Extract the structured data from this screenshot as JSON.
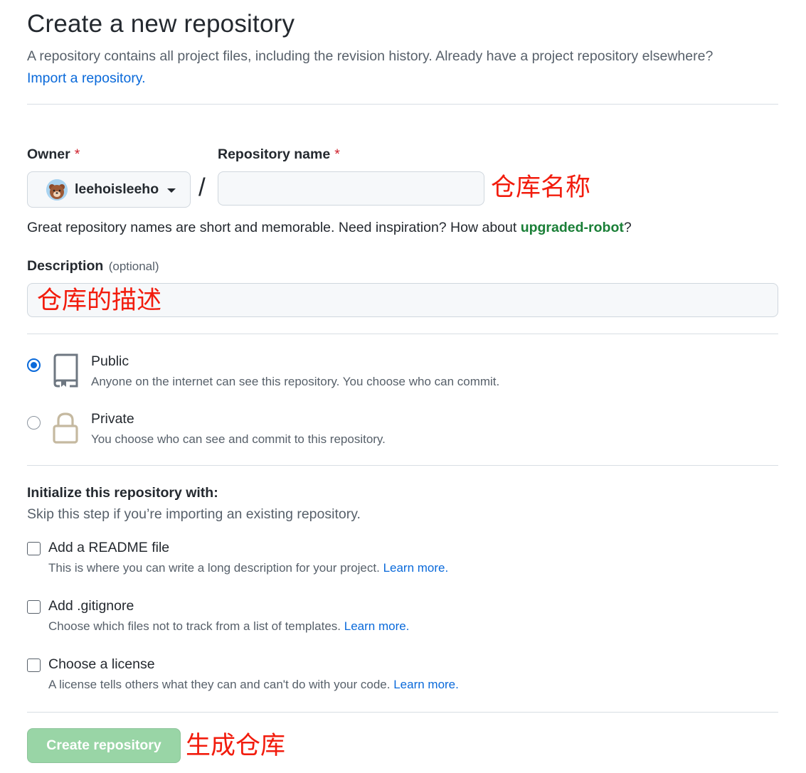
{
  "header": {
    "title": "Create a new repository",
    "subtitle": "A repository contains all project files, including the revision history. Already have a project repository elsewhere?",
    "import_link": "Import a repository."
  },
  "owner": {
    "label": "Owner",
    "required_mark": "*",
    "value": "leehoisleeho",
    "caret_icon": "triangle-down-icon"
  },
  "repo_name": {
    "label": "Repository name",
    "required_mark": "*",
    "value": "",
    "separator": "/",
    "annotation": "仓库名称"
  },
  "name_hint": {
    "prefix": "Great repository names are short and memorable. Need inspiration? How about ",
    "suggestion": "upgraded-robot",
    "suffix": "?"
  },
  "description": {
    "label": "Description",
    "optional": "(optional)",
    "value": "",
    "annotation": "仓库的描述"
  },
  "visibility": {
    "selected": "public",
    "options": [
      {
        "id": "public",
        "title": "Public",
        "desc": "Anyone on the internet can see this repository. You choose who can commit.",
        "icon": "repo-icon"
      },
      {
        "id": "private",
        "title": "Private",
        "desc": "You choose who can see and commit to this repository.",
        "icon": "lock-icon"
      }
    ]
  },
  "init": {
    "title": "Initialize this repository with:",
    "subtitle": "Skip this step if you’re importing an existing repository.",
    "items": [
      {
        "title": "Add a README file",
        "desc": "This is where you can write a long description for your project.",
        "link": "Learn more.",
        "checked": false
      },
      {
        "title": "Add .gitignore",
        "desc": "Choose which files not to track from a list of templates.",
        "link": "Learn more.",
        "checked": false
      },
      {
        "title": "Choose a license",
        "desc": "A license tells others what they can and can't do with your code.",
        "link": "Learn more.",
        "checked": false
      }
    ]
  },
  "submit": {
    "label": "Create repository",
    "annotation": "生成仓库",
    "disabled": true
  },
  "colors": {
    "accent": "#0969da",
    "annotation": "#f21c0d",
    "suggestion": "#1a7f37",
    "button_disabled": "#94d3a2",
    "lock_icon": "#c5b9a0"
  }
}
